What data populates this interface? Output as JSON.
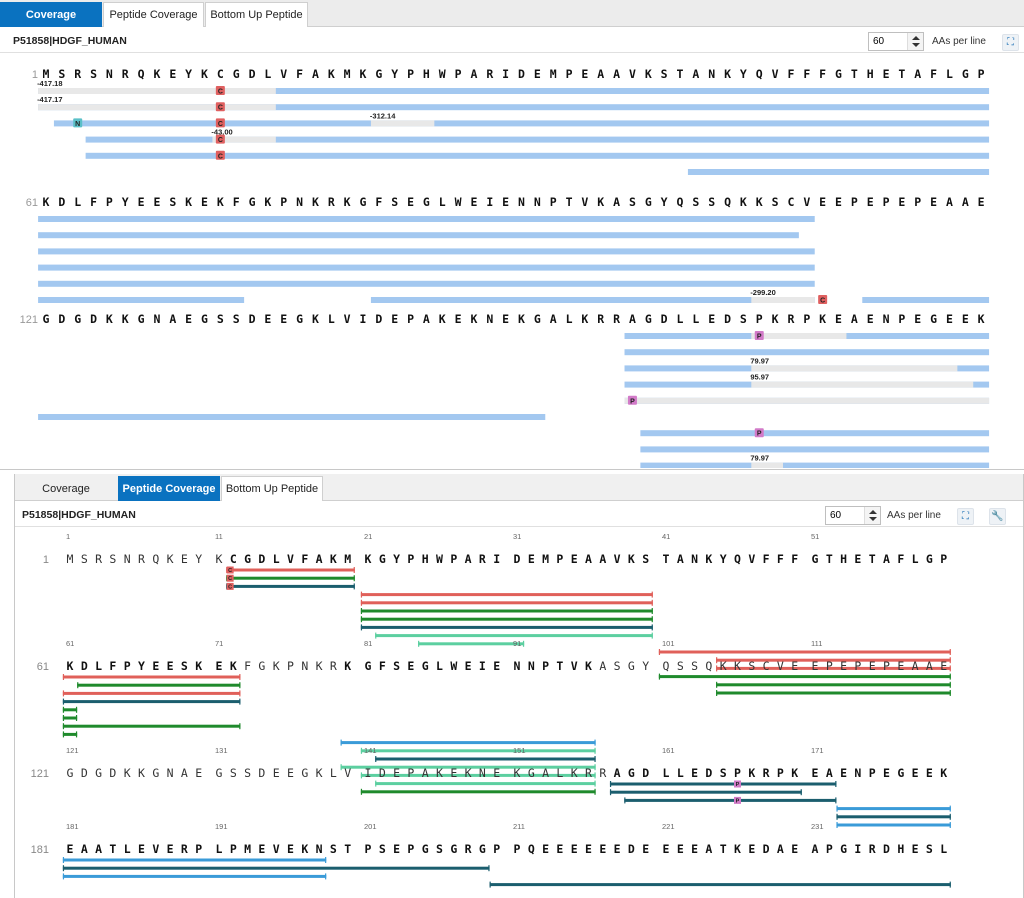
{
  "tabs": [
    {
      "label": "Coverage"
    },
    {
      "label": "Peptide Coverage"
    },
    {
      "label": "Bottom Up Peptide"
    }
  ],
  "protein": "P51858|HDGF_HUMAN",
  "aas_per_line_value": "60",
  "aas_per_line_label": "AAs per line",
  "sequence": [
    "MSRSNRQKEYKCGDLVFAKMKGYPHWPARIDEMPEAAVKSTANKYQVFFFGTHETAFLGP",
    "KDLFPYEESKEKFGKPNKRKGFSEGLWEIENNPTVKASGYQSSQKKSCVEEPEPEPEAAE",
    "GDGDKKGNAEGSSDEEGKLVIDEPAKEKNEKGALKRRAGDLLEDSPKRPKEAENPEGEEK",
    "EAATLEVERPLPMEVEKNSTPSEPGSGRGPPQEEEEEEDEEEEATKEDAEAPGIRDHESL"
  ],
  "row_numbers": [
    "1",
    "61",
    "121",
    "181"
  ],
  "ticks": [
    [
      "1",
      "11",
      "21",
      "31",
      "41",
      "51"
    ],
    [
      "61",
      "71",
      "81",
      "91",
      "101",
      "111"
    ],
    [
      "121",
      "131",
      "141",
      "151",
      "161",
      "171"
    ],
    [
      "181",
      "191",
      "201",
      "211",
      "221",
      "231"
    ]
  ],
  "colors": {
    "tab_active": "#0a72c0",
    "coverage_bar": "#a3c8f0",
    "modified_gap": "#e8e8e8",
    "mod_c": "#e06060",
    "mod_n": "#5bc0c8",
    "mod_p": "#d27ac8",
    "pep_red": "#e0605a",
    "pep_green": "#1f8a2c",
    "pep_teal": "#1b5e6e",
    "pep_mint": "#5ccfa0",
    "pep_blue": "#3a9bd8"
  },
  "coverage_rows": [
    [
      {
        "s": 1,
        "e": 60,
        "gap": [
          1,
          15
        ],
        "label": "-417.18",
        "labelAt": 1,
        "mod": {
          "at": 12,
          "t": "C"
        }
      },
      {
        "s": 1,
        "e": 60,
        "gap": [
          1,
          15
        ],
        "label": "-417.17",
        "labelAt": 1,
        "mod": {
          "at": 12,
          "t": "C"
        }
      },
      {
        "s": 2,
        "e": 60,
        "gap": [
          22,
          25
        ],
        "label": "-312.14",
        "labelAt": 22,
        "mod": {
          "at": 12,
          "t": "C"
        },
        "mod2": {
          "at": 3,
          "t": "N"
        }
      },
      {
        "s": 4,
        "e": 60,
        "gap": [
          12,
          15
        ],
        "label": "-43.00",
        "labelAt": 12,
        "mod": {
          "at": 12,
          "t": "C"
        }
      },
      {
        "s": 4,
        "e": 60,
        "mod": {
          "at": 12,
          "t": "C"
        }
      },
      {
        "s": 42,
        "e": 60
      }
    ],
    [
      {
        "s": 61,
        "e": 109
      },
      {
        "s": 61,
        "e": 108
      },
      {
        "s": 61,
        "e": 109
      },
      {
        "s": 61,
        "e": 109
      },
      {
        "s": 61,
        "e": 109
      },
      {
        "s": 61,
        "e": 73
      },
      {
        "s": 82,
        "e": 109,
        "gap": [
          106,
          109
        ],
        "label": "-299.20",
        "labelAt": 106,
        "mod": {
          "at": 110,
          "t": "C"
        },
        "tail": [
          113,
          120
        ]
      }
    ],
    [
      {
        "s": 158,
        "e": 180,
        "gap": [
          166,
          171
        ],
        "mod": {
          "at": 166,
          "t": "P"
        }
      },
      {
        "s": 158,
        "e": 180
      },
      {
        "s": 158,
        "e": 180,
        "gap": [
          166,
          178
        ],
        "label": "79.97",
        "labelAt": 166
      },
      {
        "s": 158,
        "e": 180,
        "gap": [
          166,
          179
        ],
        "label": "95.97",
        "labelAt": 166
      },
      {
        "s": 158,
        "e": 180,
        "gap": [
          158,
          180
        ],
        "mod": {
          "at": 158,
          "t": "P"
        }
      },
      {
        "s": 121,
        "e": 152
      },
      {
        "s": 159,
        "e": 180,
        "mod": {
          "at": 166,
          "t": "P"
        }
      },
      {
        "s": 159,
        "e": 180
      },
      {
        "s": 159,
        "e": 180,
        "gap": [
          166,
          167
        ],
        "label": "79.97",
        "labelAt": 166
      },
      {
        "s": 159,
        "e": 163,
        "gap": [
          164,
          180
        ],
        "mod": {
          "at": 163,
          "t": "P"
        }
      }
    ]
  ],
  "peptide_rows": [
    [
      {
        "s": 12,
        "e": 20,
        "c": "pep_red",
        "mod": "C"
      },
      {
        "s": 12,
        "e": 20,
        "c": "pep_green",
        "mod": "C"
      },
      {
        "s": 12,
        "e": 20,
        "c": "pep_teal",
        "mod": "C"
      },
      {
        "s": 21,
        "e": 40,
        "c": "pep_red"
      },
      {
        "s": 21,
        "e": 40,
        "c": "pep_red"
      },
      {
        "s": 21,
        "e": 40,
        "c": "pep_green"
      },
      {
        "s": 21,
        "e": 40,
        "c": "pep_green"
      },
      {
        "s": 21,
        "e": 40,
        "c": "pep_teal"
      },
      {
        "s": 22,
        "e": 40,
        "c": "pep_mint"
      },
      {
        "s": 25,
        "e": 31,
        "c": "pep_mint"
      },
      {
        "s": 41,
        "e": 60,
        "c": "pep_red"
      },
      {
        "s": 45,
        "e": 60,
        "c": "pep_red"
      },
      {
        "s": 45,
        "e": 60,
        "c": "pep_red"
      },
      {
        "s": 41,
        "e": 60,
        "c": "pep_green"
      },
      {
        "s": 45,
        "e": 60,
        "c": "pep_green"
      },
      {
        "s": 45,
        "e": 60,
        "c": "pep_green"
      }
    ],
    [
      {
        "s": 61,
        "e": 72,
        "c": "pep_red"
      },
      {
        "s": 62,
        "e": 72,
        "c": "pep_green"
      },
      {
        "s": 61,
        "e": 72,
        "c": "pep_red"
      },
      {
        "s": 61,
        "e": 72,
        "c": "pep_teal"
      },
      {
        "s": 61,
        "e": 61,
        "c": "pep_green"
      },
      {
        "s": 61,
        "e": 61,
        "c": "pep_green"
      },
      {
        "s": 61,
        "e": 72,
        "c": "pep_green"
      },
      {
        "s": 61,
        "e": 61,
        "c": "pep_green"
      },
      {
        "s": 80,
        "e": 96,
        "c": "pep_blue"
      },
      {
        "s": 81,
        "e": 96,
        "c": "pep_mint"
      },
      {
        "s": 82,
        "e": 96,
        "c": "pep_teal"
      },
      {
        "s": 80,
        "e": 96,
        "c": "pep_mint"
      },
      {
        "s": 81,
        "e": 96,
        "c": "pep_mint"
      },
      {
        "s": 82,
        "e": 96,
        "c": "pep_mint"
      },
      {
        "s": 81,
        "e": 96,
        "c": "pep_green"
      }
    ],
    [
      {
        "s": 158,
        "e": 172,
        "c": "pep_teal",
        "mod": "P",
        "modAt": 166
      },
      {
        "s": 158,
        "e": 170,
        "c": "pep_teal"
      },
      {
        "s": 159,
        "e": 172,
        "c": "pep_teal",
        "mod": "P",
        "modAt": 166
      },
      {
        "s": 173,
        "e": 180,
        "c": "pep_blue"
      },
      {
        "s": 173,
        "e": 180,
        "c": "pep_teal"
      },
      {
        "s": 173,
        "e": 180,
        "c": "pep_blue"
      }
    ],
    [
      {
        "s": 181,
        "e": 198,
        "c": "pep_blue"
      },
      {
        "s": 181,
        "e": 209,
        "c": "pep_teal"
      },
      {
        "s": 181,
        "e": 198,
        "c": "pep_blue"
      },
      {
        "s": 210,
        "e": 240,
        "c": "pep_teal"
      }
    ]
  ],
  "pep_spaced_groups": [
    [
      [
        12,
        20
      ],
      [
        21,
        40
      ],
      [
        41,
        60
      ]
    ],
    [
      [
        61,
        72
      ],
      [
        80,
        96
      ]
    ],
    [
      [
        157,
        180
      ]
    ],
    [
      [
        181,
        240
      ]
    ]
  ]
}
